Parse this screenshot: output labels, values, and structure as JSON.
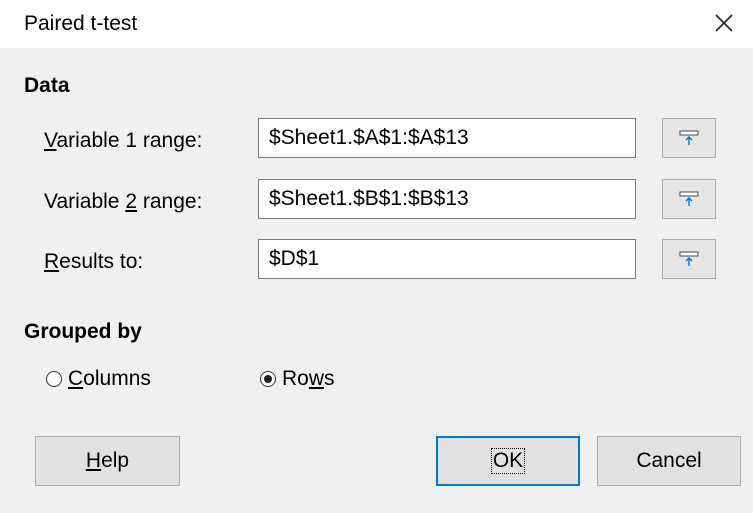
{
  "window": {
    "title": "Paired t-test"
  },
  "data_section": {
    "label": "Data",
    "rows": [
      {
        "label_prefix": "",
        "label_accel": "V",
        "label_suffix": "ariable 1 range:",
        "value": "$Sheet1.$A$1:$A$13"
      },
      {
        "label_prefix": "Variable ",
        "label_accel": "2",
        "label_suffix": " range:",
        "value": "$Sheet1.$B$1:$B$13"
      },
      {
        "label_prefix": "",
        "label_accel": "R",
        "label_suffix": "esults to:",
        "value": "$D$1"
      }
    ]
  },
  "grouped_by": {
    "label": "Grouped by",
    "columns": {
      "accel": "C",
      "rest": "olumns",
      "selected": false
    },
    "rows": {
      "pre": "Ro",
      "accel": "w",
      "rest": "s",
      "selected": true
    }
  },
  "buttons": {
    "help": {
      "accel": "H",
      "rest": "elp"
    },
    "ok": {
      "label": "OK"
    },
    "cancel": {
      "label": "Cancel"
    }
  },
  "icons": {
    "close": "close-icon",
    "shrink": "shrink-range-icon",
    "accent": "#0078d7"
  }
}
